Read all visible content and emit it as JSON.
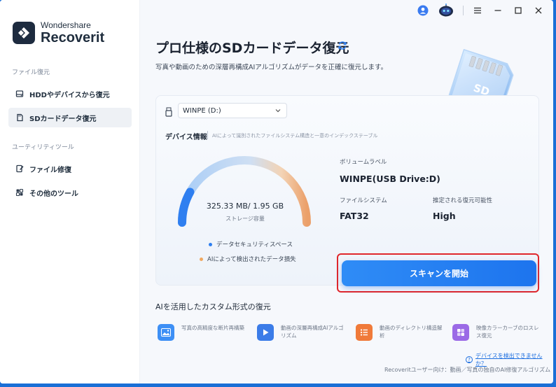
{
  "app": {
    "logo_top": "Wondershare",
    "logo_bottom": "Recoverit"
  },
  "sidebar": {
    "section1": "ファイル復元",
    "items1": [
      {
        "label": "HDDやデバイスから復元",
        "icon": "hdd-icon"
      },
      {
        "label": "SDカードデータ復元",
        "icon": "sd-card-icon",
        "active": true
      }
    ],
    "section2": "ユーティリティツール",
    "items2": [
      {
        "label": "ファイル修復",
        "icon": "file-repair-icon"
      },
      {
        "label": "その他のツール",
        "icon": "more-tools-icon"
      }
    ]
  },
  "topbar": {
    "icons": [
      "user-icon",
      "robot-icon",
      "menu-icon",
      "minimize-icon",
      "maximize-icon",
      "close-icon"
    ]
  },
  "main": {
    "title": "プロ仕様のSDカードデータ復元",
    "subtitle": "写真や動画のための深層再構成AIアルゴリズムがデータを正確に復元します。",
    "sd_card_text": "SD"
  },
  "device": {
    "selected_drive": "WINPE (D:)",
    "info_title": "デバイス情報",
    "info_desc": "AIによって識別されたファイルシステム構造と一意のインデックステーブル",
    "storage_value": "325.33 MB/ 1.95 GB",
    "storage_label": "ストレージ容量",
    "storage_used_fraction": 0.163,
    "legend": [
      {
        "label": "データセキュリティスペース",
        "color": "#2f7ff0"
      },
      {
        "label": "AIによって検出されたデータ損失",
        "color": "#f0a860"
      }
    ],
    "volume_label_title": "ボリュームラベル",
    "volume_label_value": "WINPE(USB Drive:D)",
    "fs_title": "ファイルシステム",
    "fs_value": "FAT32",
    "recover_title": "推定される復元可能性",
    "recover_value": "High",
    "scan_button": "スキャンを開始"
  },
  "features": {
    "title": "AIを活用したカスタム形式の復元",
    "items": [
      {
        "text": "写真の高精度な断片再構築",
        "icon": "photo-icon",
        "color": "#3d8ff5"
      },
      {
        "text": "動画の深層再構成AIアルゴリズム",
        "icon": "video-icon",
        "color": "#3b7ce8"
      },
      {
        "text": "動画のディレクトリ構造解析",
        "icon": "list-icon",
        "color": "#f07a3a"
      },
      {
        "text": "映像カラーカーブのロスレス復元",
        "icon": "color-icon",
        "color": "#9b6ae6"
      }
    ]
  },
  "footer": {
    "help_link": "デバイスを検出できませんか？",
    "text": "Recoveritユーザー向け：動画／写真の独自のAI修復アルゴリズム"
  }
}
